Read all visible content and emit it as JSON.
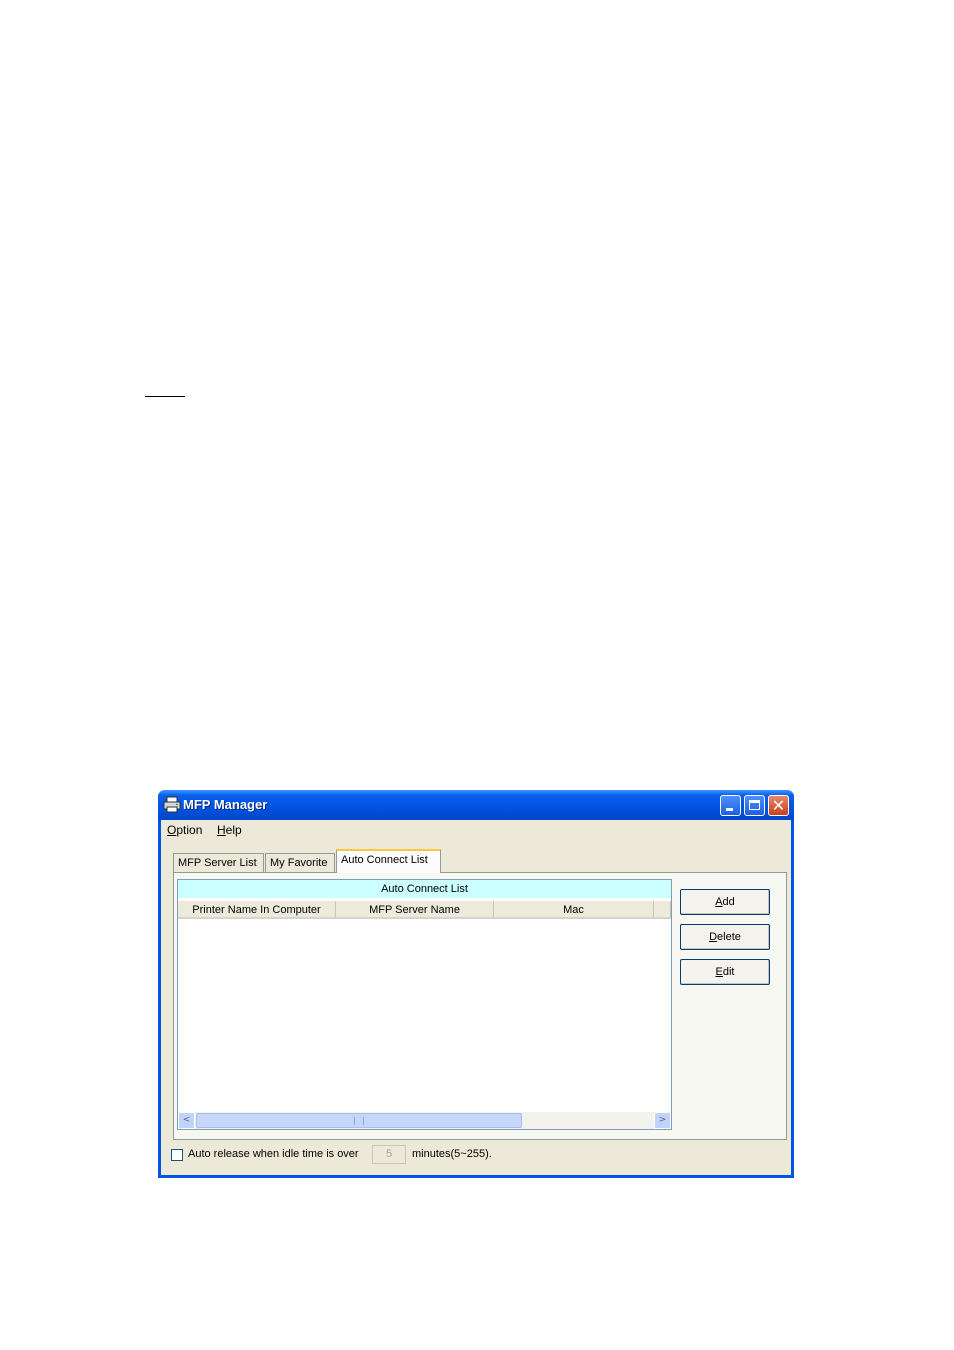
{
  "window": {
    "title": "MFP Manager",
    "title_icon": "printer-icon",
    "close_glyph": "✕"
  },
  "menu": {
    "items": [
      {
        "prefix": "",
        "accel": "O",
        "rest": "ption"
      },
      {
        "prefix": "",
        "accel": "H",
        "rest": "elp"
      }
    ]
  },
  "tabs": [
    {
      "label": "MFP Server List"
    },
    {
      "label": "My Favorite"
    },
    {
      "label": "Auto Connect List",
      "active": true
    }
  ],
  "list": {
    "caption": "Auto Connect List",
    "columns": [
      "Printer Name In Computer",
      "MFP Server Name",
      "Mac",
      ""
    ],
    "rows": []
  },
  "scrollbar": {
    "left_arrow": "<",
    "right_arrow": ">"
  },
  "buttons": [
    {
      "accel": "A",
      "rest": "dd"
    },
    {
      "accel": "D",
      "rest": "elete"
    },
    {
      "accel": "E",
      "rest": "dit"
    }
  ],
  "auto_release": {
    "checked": false,
    "label_before": "Auto release when idle time is over",
    "value": "5",
    "label_after": "minutes(5~255)."
  }
}
